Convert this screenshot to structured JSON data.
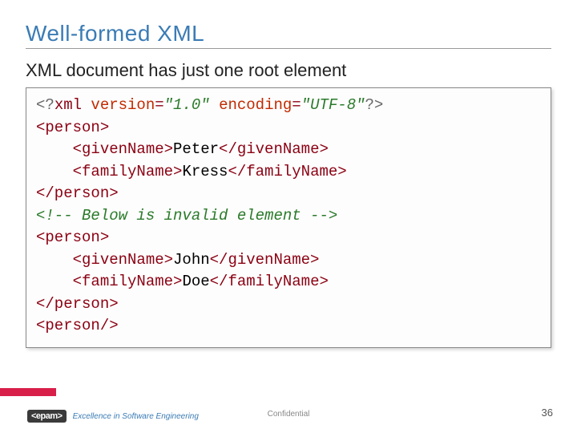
{
  "title": "Well-formed XML",
  "subtitle": "XML document has just one root element",
  "code_tokens": [
    [
      [
        "pi",
        "<?"
      ],
      [
        "tag",
        "xml "
      ],
      [
        "attr",
        "version"
      ],
      [
        "tag",
        "="
      ],
      [
        "val",
        "\"1.0\""
      ],
      [
        "tag",
        " "
      ],
      [
        "attr",
        "encoding"
      ],
      [
        "tag",
        "="
      ],
      [
        "val",
        "\"UTF-8\""
      ],
      [
        "pi",
        "?>"
      ]
    ],
    [
      [
        "tag",
        "<person>"
      ]
    ],
    [
      [
        "txt",
        "    "
      ],
      [
        "tag",
        "<givenName>"
      ],
      [
        "txt",
        "Peter"
      ],
      [
        "tag",
        "</givenName>"
      ]
    ],
    [
      [
        "txt",
        "    "
      ],
      [
        "tag",
        "<familyName>"
      ],
      [
        "txt",
        "Kress"
      ],
      [
        "tag",
        "</familyName>"
      ]
    ],
    [
      [
        "tag",
        "</person>"
      ]
    ],
    [
      [
        "comment",
        "<!-- Below is invalid element -->"
      ]
    ],
    [
      [
        "tag",
        "<person>"
      ]
    ],
    [
      [
        "txt",
        "    "
      ],
      [
        "tag",
        "<givenName>"
      ],
      [
        "txt",
        "John"
      ],
      [
        "tag",
        "</givenName>"
      ]
    ],
    [
      [
        "txt",
        "    "
      ],
      [
        "tag",
        "<familyName>"
      ],
      [
        "txt",
        "Doe"
      ],
      [
        "tag",
        "</familyName>"
      ]
    ],
    [
      [
        "tag",
        "</person>"
      ]
    ],
    [
      [
        "tag",
        "<person/>"
      ]
    ]
  ],
  "footer": {
    "logo_text": "<epam>",
    "tagline": "Excellence in Software Engineering",
    "confidential": "Confidential",
    "page": "36"
  }
}
